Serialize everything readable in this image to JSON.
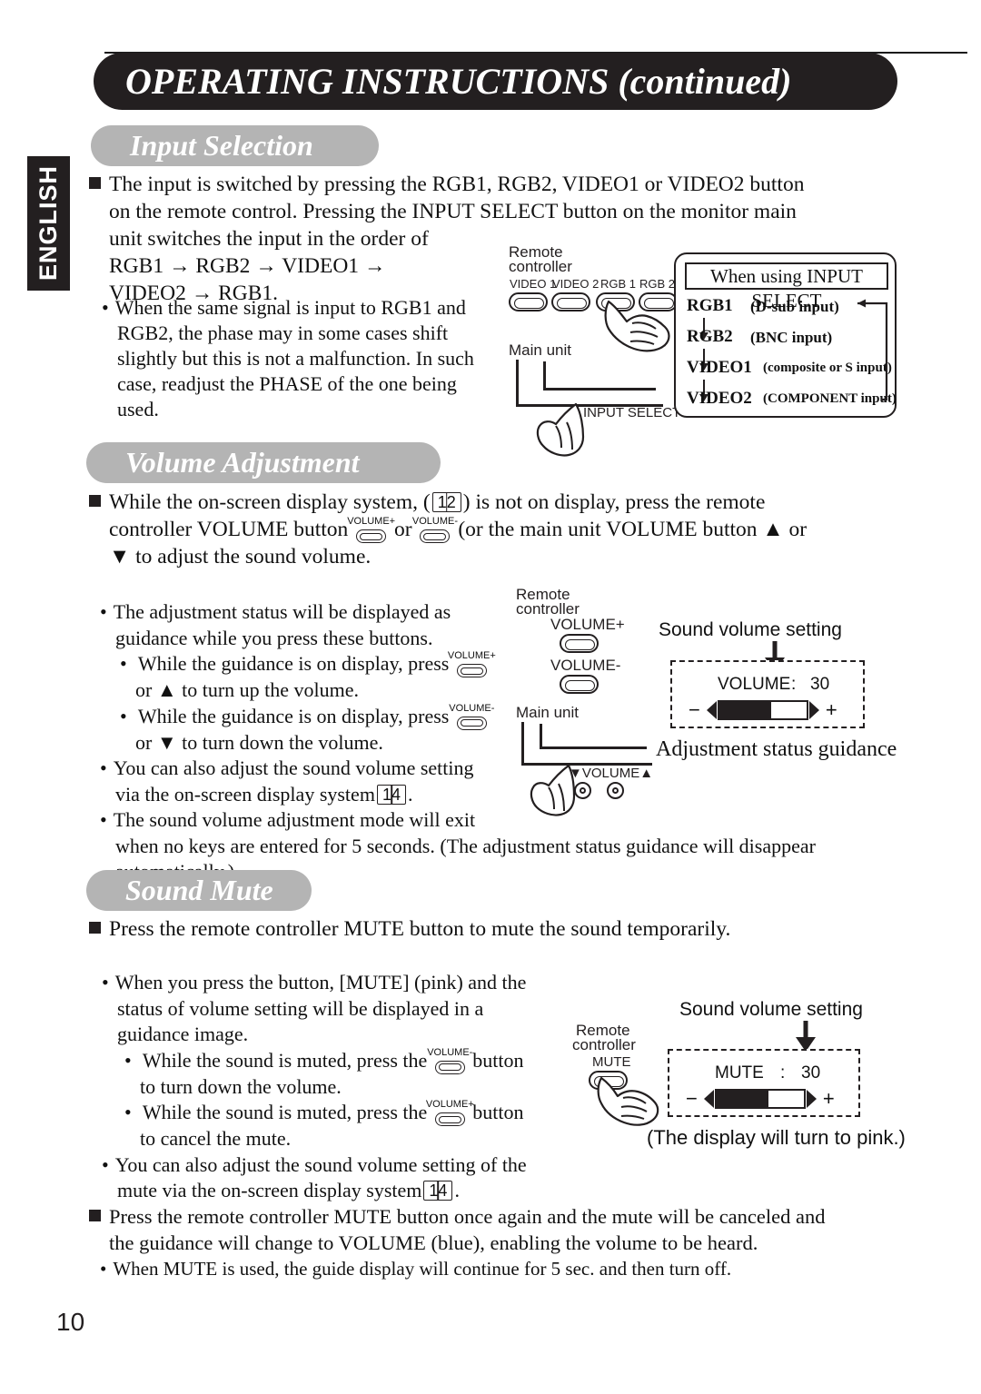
{
  "page": {
    "header_title": "OPERATING INSTRUCTIONS (continued)",
    "language_tab": "ENGLISH",
    "page_number": "10"
  },
  "sections": {
    "input_selection": {
      "heading": "Input Selection",
      "paragraph_lines": [
        "The input is switched by pressing the RGB1, RGB2, VIDEO1 or VIDEO2 button",
        "on the remote control. Pressing the INPUT SELECT button on the monitor main",
        "unit switches the input in the order of",
        "RGB1 → RGB2 → VIDEO1 →",
        "VIDEO2 → RGB1."
      ],
      "note_lines": [
        "When the same signal is input to RGB1 and",
        "RGB2, the phase may in some cases shift",
        "slightly but this is not a malfunction. In such",
        "case, readjust the PHASE of the one being",
        "used."
      ],
      "figure": {
        "remote_label_line1": "Remote",
        "remote_label_line2": "controller",
        "remote_buttons": [
          "VIDEO 1",
          "VIDEO 2",
          "RGB 1",
          "RGB 2"
        ],
        "main_unit_label": "Main unit",
        "input_select_label": "INPUT SELECT",
        "panel_title": "When using INPUT SELECT",
        "flow": [
          {
            "name": "RGB1",
            "desc": "(D-sub input)"
          },
          {
            "name": "RGB2",
            "desc": "(BNC input)"
          },
          {
            "name": "VIDEO1",
            "desc": "(composite or S input)"
          },
          {
            "name": "VIDEO2",
            "desc": "(COMPONENT input)"
          }
        ]
      }
    },
    "volume_adjustment": {
      "heading": "Volume Adjustment",
      "intro": {
        "l1a": "While the on-screen display system, (",
        "l1_ref": "12",
        "l1b": ") is not on display, press the remote",
        "l2a": "controller VOLUME button",
        "l2_btn1": "VOLUME+",
        "l2_or": "or",
        "l2_btn2": "VOLUME-",
        "l2b": "(or the main unit VOLUME button ▲ or",
        "l3": "▼ to adjust the sound volume."
      },
      "bullets": {
        "b1_l1": "The adjustment status will be displayed as",
        "b1_l2": "guidance while you press these buttons.",
        "b1_sub1_a": "While the guidance is on display, press",
        "b1_sub1_btn": "VOLUME+",
        "b1_sub1_b": "or ▲ to turn up the volume.",
        "b1_sub2_a": "While the guidance is on display, press",
        "b1_sub2_btn": "VOLUME-",
        "b1_sub2_b": "or ▼ to turn down the volume.",
        "b2_l1": "You can also adjust the sound volume setting",
        "b2_l2a": "via the on-screen display system",
        "b2_ref": "14",
        "b2_l2b": ".",
        "b3_l1": "The sound volume adjustment mode will exit",
        "b3_l2": "when no keys are entered for 5 seconds.  (The adjustment status guidance will disappear",
        "b3_l3": "automatically.)"
      },
      "figure": {
        "remote_label_line1": "Remote",
        "remote_label_line2": "controller",
        "button_plus": "VOLUME+",
        "button_minus": "VOLUME-",
        "main_unit_label": "Main unit",
        "main_unit_volume": "VOLUME",
        "sound_volume_setting": "Sound volume setting",
        "guide_name": "VOLUME",
        "guide_sep": ":",
        "guide_value": "30",
        "guide_minus": "−",
        "guide_plus": "+",
        "caption": "Adjustment status guidance",
        "bar_fill_percent": 60
      }
    },
    "sound_mute": {
      "heading": "Sound Mute",
      "statement": "Press the remote controller MUTE button to mute the sound temporarily.",
      "bullets": {
        "b1_l1": "When you press the button, [MUTE] (pink) and the",
        "b1_l2": "status of volume setting will be displayed in a",
        "b1_l3": "guidance image.",
        "b1_sub1_a": "While the sound is muted, press the",
        "b1_sub1_btn": "VOLUME-",
        "b1_sub1_b": "button",
        "b1_sub1_c": "to turn down the volume.",
        "b1_sub2_a": "While the sound is muted, press the",
        "b1_sub2_btn": "VOLUME+",
        "b1_sub2_b": "button",
        "b1_sub2_c": "to cancel the mute.",
        "b2_l1": "You can also adjust the sound volume setting of the",
        "b2_l2a": "mute via the on-screen display system",
        "b2_ref": "14",
        "b2_l2b": "."
      },
      "figure": {
        "remote_label_line1": "Remote",
        "remote_label_line2": "controller",
        "mute_button": "MUTE",
        "sound_volume_setting": "Sound volume setting",
        "guide_name": "MUTE",
        "guide_sep": ":",
        "guide_value": "30",
        "guide_minus": "−",
        "guide_plus": "+",
        "caption": "(The display will turn to pink.)",
        "bar_fill_percent": 60
      },
      "closing": {
        "p_l1": "Press the remote controller MUTE button once again and the mute will be canceled and",
        "p_l2": "the guidance will change to VOLUME (blue), enabling the volume to be heard.",
        "note": "When MUTE is used, the guide display will continue for 5 sec. and then turn off."
      }
    }
  }
}
